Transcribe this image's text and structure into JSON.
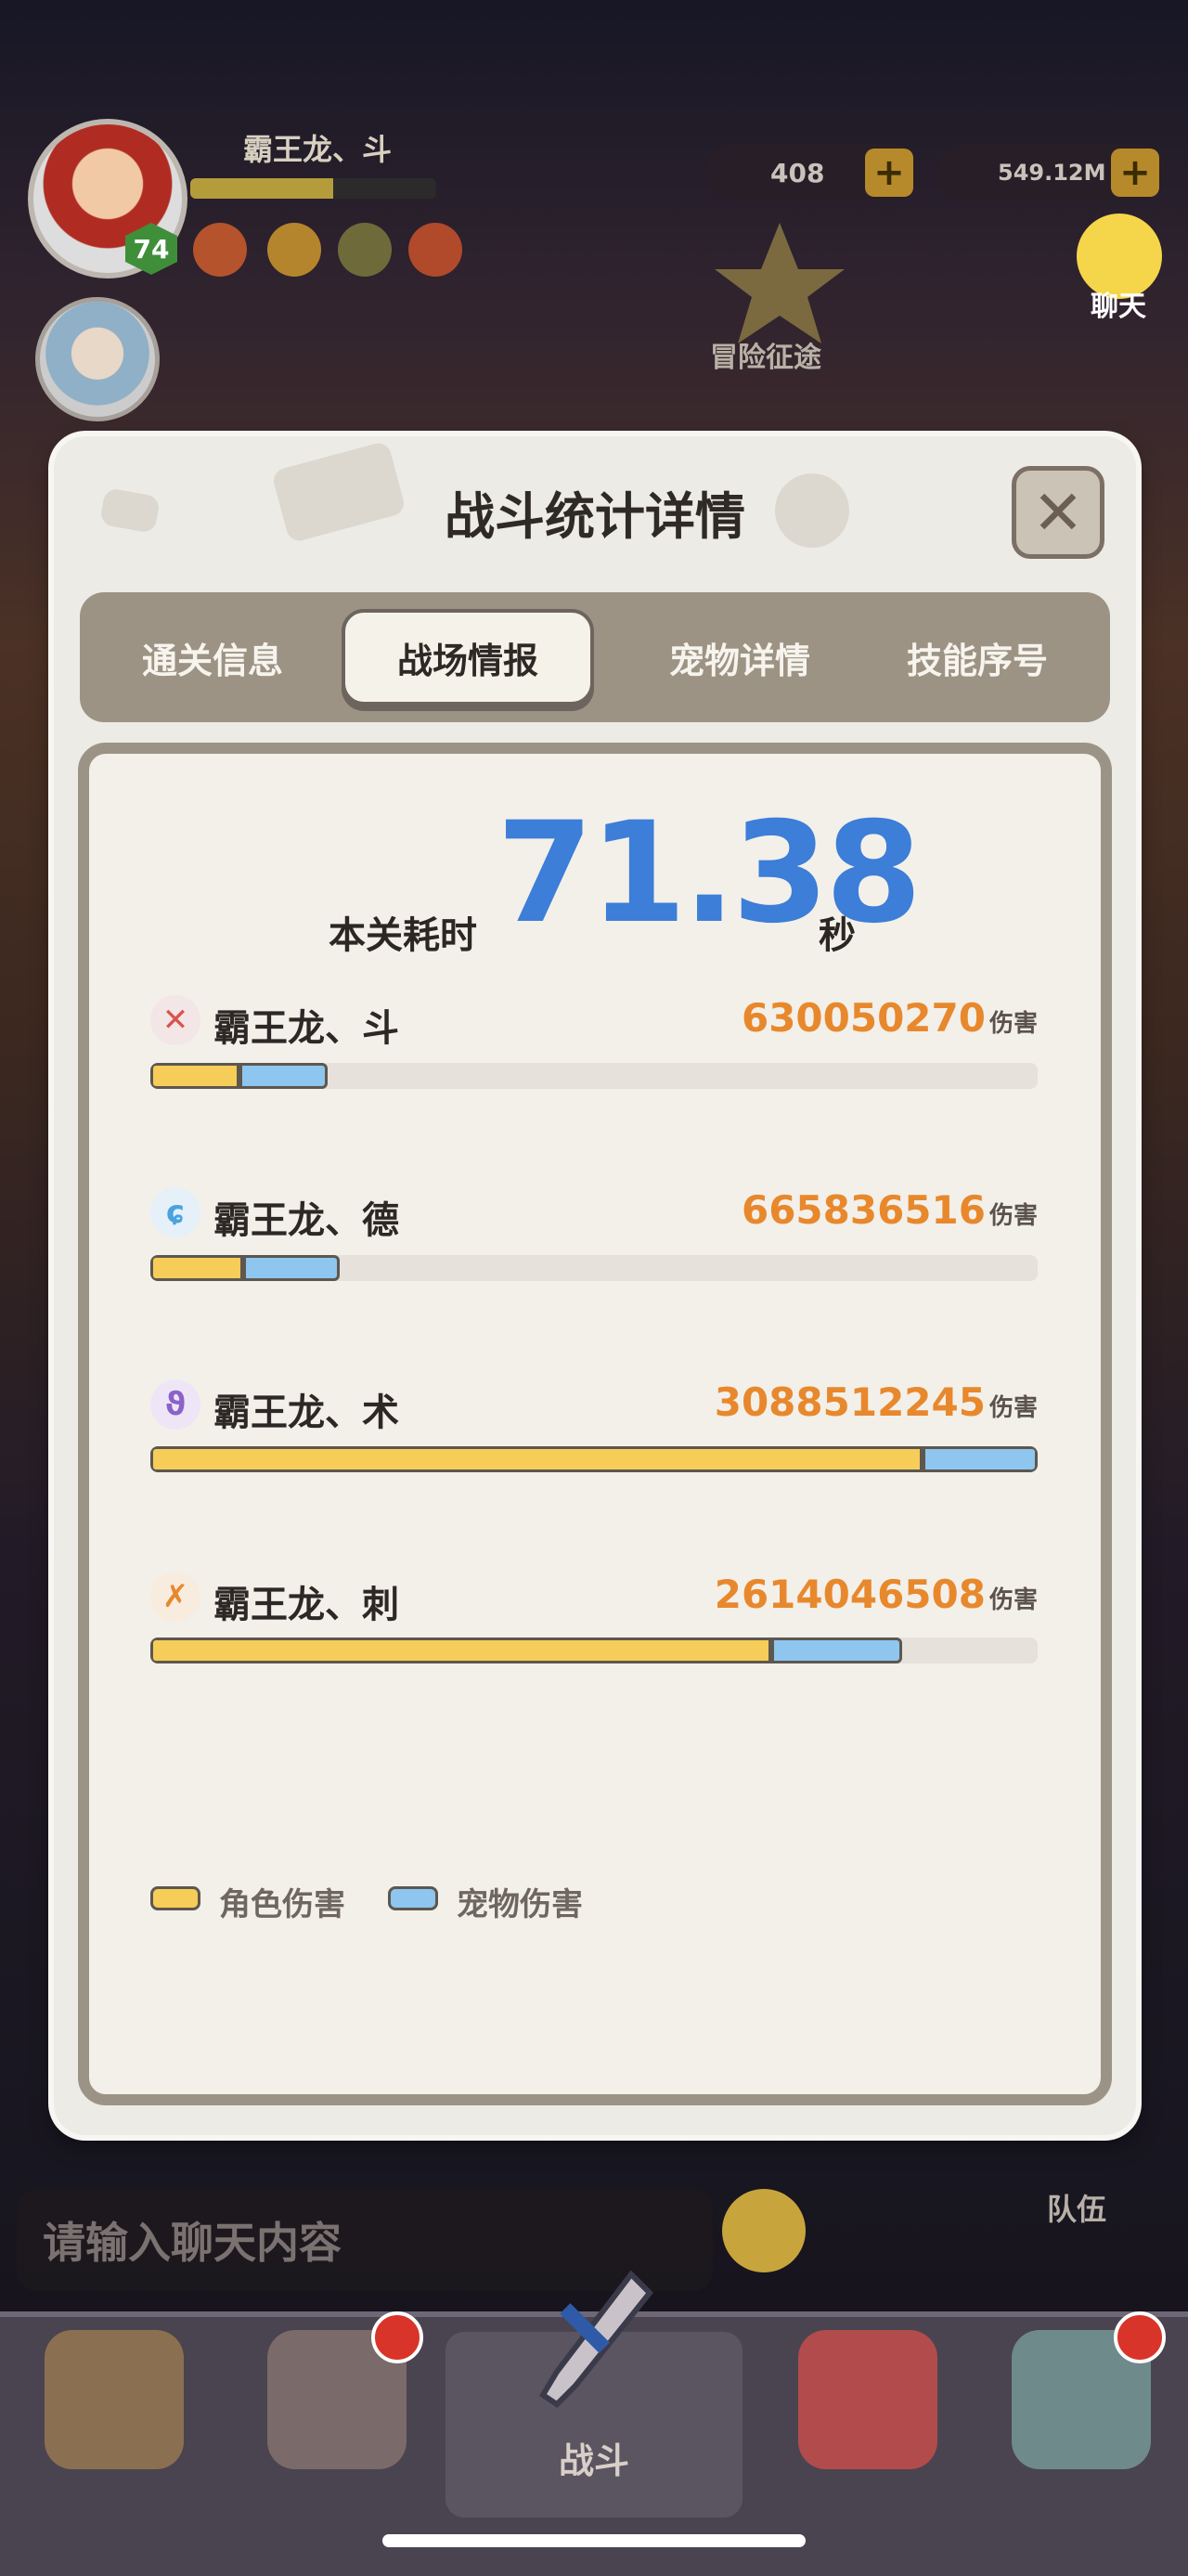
{
  "hud": {
    "player_name": "霸王龙、斗",
    "level": "74",
    "currency_1": "408",
    "currency_2": "549.12M",
    "plus_symbol": "+",
    "chat_top_label": "聊天",
    "adventure_label": "冒险征途"
  },
  "modal": {
    "title": "战斗统计详情",
    "close_symbol": "✕",
    "tabs": [
      {
        "label": "通关信息"
      },
      {
        "label": "战场情报"
      },
      {
        "label": "宠物详情"
      },
      {
        "label": "技能序号"
      }
    ],
    "active_tab_index": 1,
    "time_label": "本关耗时",
    "time_value": "71.38",
    "time_unit": "秒",
    "damage_suffix": "伤害",
    "rows": [
      {
        "name": "霸王龙、斗",
        "damage": "630050270",
        "role_fraction": 0.1,
        "pet_fraction": 0.1,
        "icon": "fist-icon",
        "icon_glyph": "✕",
        "icon_color": "#d9534f"
      },
      {
        "name": "霸王龙、德",
        "damage": "665836516",
        "role_fraction": 0.105,
        "pet_fraction": 0.108,
        "icon": "swirl-icon",
        "icon_glyph": "ɕ",
        "icon_color": "#4aa3df"
      },
      {
        "name": "霸王龙、术",
        "damage": "3088512245",
        "role_fraction": 0.87,
        "pet_fraction": 0.13,
        "icon": "magic-icon",
        "icon_glyph": "ϑ",
        "icon_color": "#8b62c9"
      },
      {
        "name": "霸王龙、刺",
        "damage": "2614046508",
        "role_fraction": 0.7,
        "pet_fraction": 0.147,
        "icon": "blade-icon",
        "icon_glyph": "✗",
        "icon_color": "#e8882d"
      }
    ],
    "legend": {
      "role_label": "角色伤害",
      "pet_label": "宠物伤害",
      "role_color": "#f5cd58",
      "pet_color": "#8ec6ef"
    }
  },
  "bottom": {
    "chat_placeholder": "请输入聊天内容",
    "team_label": "队伍",
    "battle_label": "战斗"
  }
}
